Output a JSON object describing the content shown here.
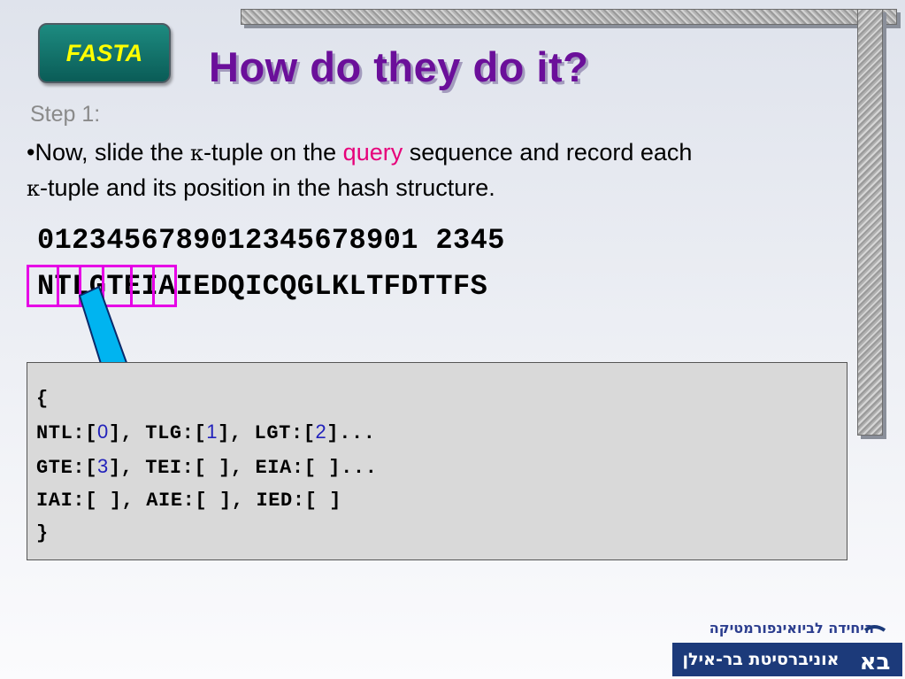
{
  "badge": {
    "label": "FASTA"
  },
  "title": "How do they do it?",
  "step_label": "Step 1:",
  "bullet": {
    "prefix": "•Now, slide the ",
    "kappa": "κ",
    "part2": "-tuple on the ",
    "query_word": "query",
    "part3": " sequence and record each",
    "kappa2": "κ",
    "part4": "-tuple and its position in the hash structure."
  },
  "positions_row": "0123456789012345678901 2345",
  "sequence_row": "NTLGTEIAIEDQICQGLKLTFDTTFS",
  "hash": {
    "open_brace": "{",
    "close_brace": "}",
    "line1": {
      "a": "NTL:[",
      "a_idx": "0",
      "b": "], TLG:[",
      "b_idx": "1",
      "c": "], LGT:[",
      "c_idx": "2",
      "d": "]..."
    },
    "line2": {
      "a": "GTE:[",
      "a_idx": "3",
      "b": "], TEI:[ ], EIA:[ ]..."
    },
    "line3": "IAI:[ ], AIE:[ ], IED:[ ]"
  },
  "logo": {
    "unit_name": "היחידה לביואינפורמטיקה",
    "university": "אוניברסיטת בר-אילן",
    "mark": "בא"
  },
  "colors": {
    "title": "#6b0f9a",
    "query": "#e6007a",
    "selection": "#e600e6",
    "arrow": "#00b4f0",
    "badge_text": "#ffff00",
    "index": "#2222bb"
  }
}
